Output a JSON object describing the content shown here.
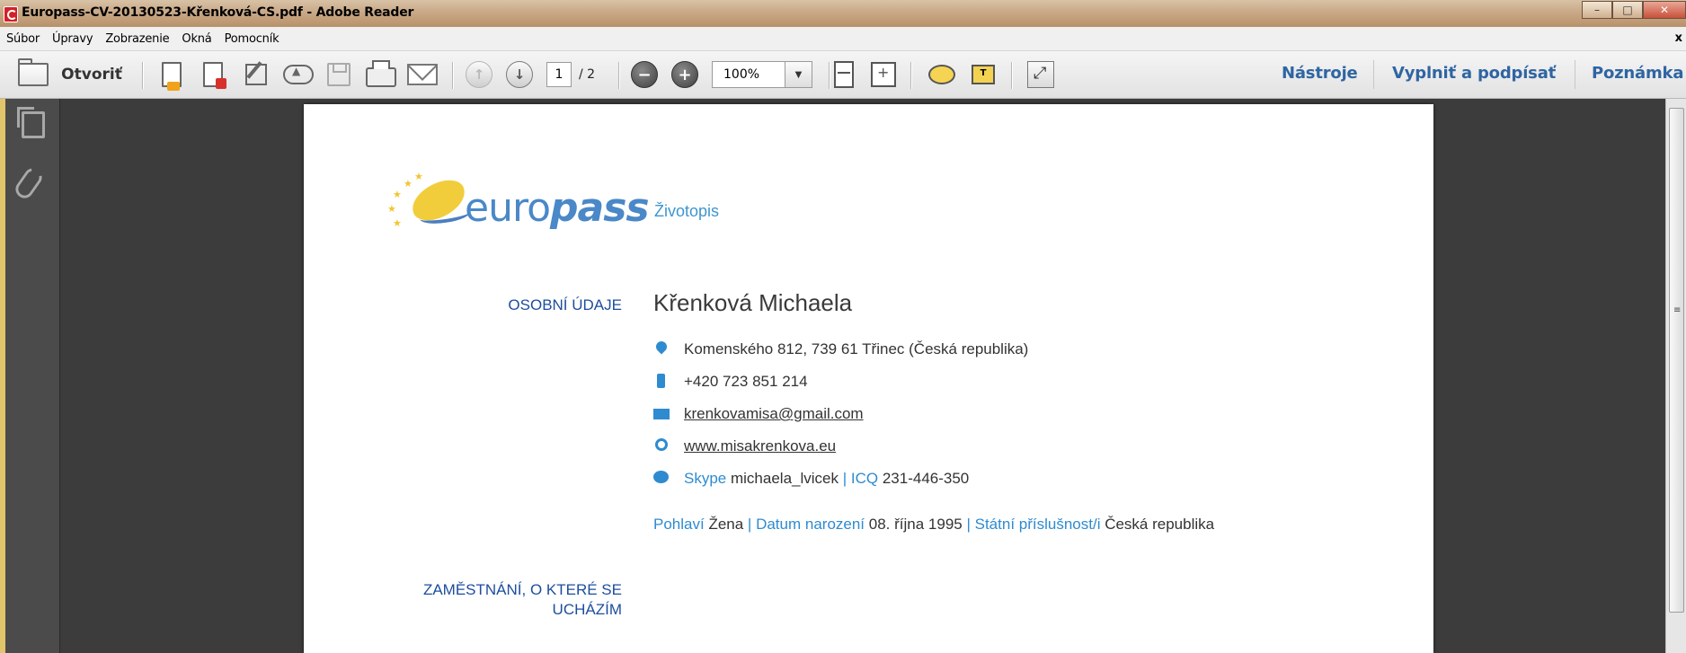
{
  "window": {
    "title": "Europass-CV-20130523-Křenková-CS.pdf - Adobe Reader"
  },
  "menu": {
    "items": [
      "Súbor",
      "Úpravy",
      "Zobrazenie",
      "Okná",
      "Pomocník"
    ],
    "close": "x"
  },
  "toolbar": {
    "open_label": "Otvoriť",
    "page_current": "1",
    "page_total": "/ 2",
    "zoom": "100%",
    "links": [
      "Nástroje",
      "Vyplniť a podpísať",
      "Poznámka"
    ]
  },
  "document": {
    "logo_text_a": "euro",
    "logo_text_b": "pass",
    "title": "Životopis",
    "section_personal": "OSOBNÍ ÚDAJE",
    "name": "Křenková Michaela",
    "address": "Komenského 812, 739 61 Třinec (Česká republika)",
    "phone": "+420 723 851 214",
    "email": "krenkovamisa@gmail.com",
    "website": "www.misakrenkova.eu",
    "im": {
      "skype_label": "Skype",
      "skype_value": "michaela_lvicek",
      "sep": "|",
      "icq_label": "ICQ",
      "icq_value": "231-446-350"
    },
    "personal": {
      "sex_label": "Pohlaví",
      "sex_value": "Žena",
      "sep": "|",
      "dob_label": "Datum narození",
      "dob_value": "08. října 1995",
      "nat_label": "Státní příslušnost/i",
      "nat_value": "Česká republika"
    },
    "section_job_line1": "ZAMĚSTNÁNÍ, O KTERÉ SE",
    "section_job_line2": "UCHÁZÍM"
  },
  "colors": {
    "link_blue": "#2f65a2",
    "section_blue": "#1d4d9e",
    "accent_blue": "#2e8bd0"
  }
}
